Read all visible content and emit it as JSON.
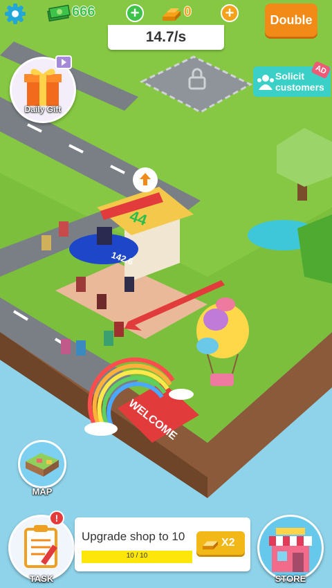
{
  "hud": {
    "cash": "666",
    "gold": "0",
    "income_rate": "14.7/s",
    "double_label": "Double"
  },
  "daily_gift": {
    "label": "Daily Gift"
  },
  "solicit": {
    "label_line1": "Solicit",
    "label_line2": "customers",
    "ad_tag": "AD"
  },
  "shop": {
    "speed": "142.6",
    "customers": "44"
  },
  "welcome_sign": "WELCOME",
  "map_button": {
    "label": "MAP"
  },
  "task": {
    "button_label": "TASK",
    "alert": "!",
    "title": "Upgrade shop to 10",
    "progress_text": "10 / 10",
    "progress_fraction": 1.0,
    "reward_label": "X2"
  },
  "store_button": {
    "label": "STORE"
  },
  "colors": {
    "cash_green": "#3fc24a",
    "gold_orange": "#f5a11a",
    "double_button": "#f28a17",
    "progress_yellow": "#ffe60a",
    "water": "#8fd3ea",
    "grass": "#7cbf3c"
  }
}
